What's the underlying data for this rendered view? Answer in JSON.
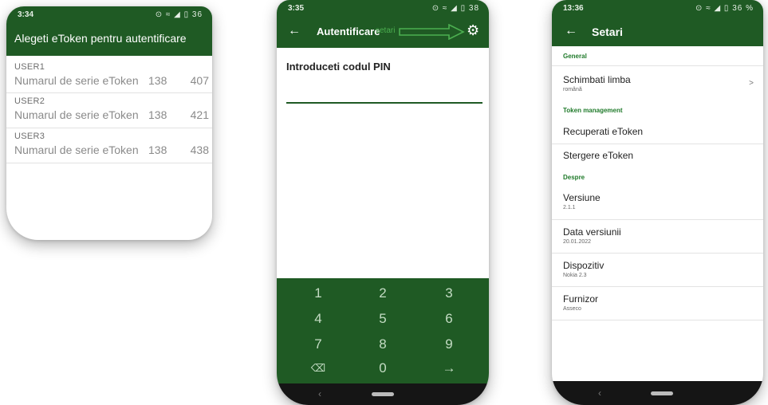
{
  "screen1": {
    "status_time": "3:34",
    "status_icons": "⊙ ≈ ◢ ▯ 36",
    "title": "Alegeti eToken pentru autentificare",
    "users": [
      {
        "name": "USER1",
        "label": "Numarul de serie eToken",
        "serial_a": "138",
        "serial_b": "407"
      },
      {
        "name": "USER2",
        "label": "Numarul de serie eToken",
        "serial_a": "138",
        "serial_b": "421"
      },
      {
        "name": "USER3",
        "label": "Numarul de serie eToken",
        "serial_a": "138",
        "serial_b": "438"
      }
    ]
  },
  "screen2": {
    "status_time": "3:35",
    "status_icons": "⊙ ≈ ◢ ▯ 38",
    "back_icon": "back-arrow-icon",
    "title": "Autentificare",
    "annotation": "setari",
    "annotation_color": "#4caf50",
    "settings_icon": "gear-icon",
    "pin_label": "Introduceti codul PIN",
    "pin_value": "",
    "keys": [
      "1",
      "2",
      "3",
      "4",
      "5",
      "6",
      "7",
      "8",
      "9",
      "⌫",
      "0",
      "→"
    ],
    "nav_back": "‹"
  },
  "screen3": {
    "status_time": "13:36",
    "status_icons": "⊙ ≈ ◢ ▯ 36 %",
    "title": "Setari",
    "sections": {
      "general": "General",
      "token": "Token management",
      "despre": "Despre"
    },
    "language": {
      "title": "Schimbati limba",
      "value": "română"
    },
    "recover": "Recuperati eToken",
    "delete": "Stergere eToken",
    "version": {
      "title": "Versiune",
      "value": "2.1.1"
    },
    "version_date": {
      "title": "Data versiunii",
      "value": "20.01.2022"
    },
    "device": {
      "title": "Dispozitiv",
      "value": "Nokia 2.3"
    },
    "provider": {
      "title": "Furnizor",
      "value": "Asseco"
    },
    "nav_back": "‹"
  },
  "colors": {
    "primary": "#1f5a24",
    "keypad_text": "#c4dcc4",
    "section_header": "#1f7a2a"
  }
}
